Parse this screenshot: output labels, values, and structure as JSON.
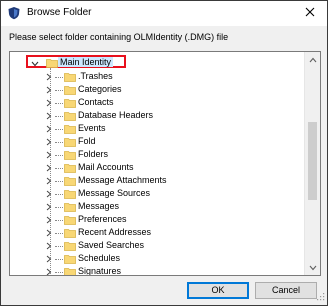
{
  "window": {
    "title": "Browse Folder",
    "close_icon": "close-icon",
    "app_icon": "shield-app-icon"
  },
  "prompt": "Please select folder containing OLMIdentity (.DMG) file",
  "tree": {
    "root": {
      "label": "Main Identity",
      "expanded": true,
      "selected": true,
      "icon": "folder-icon"
    },
    "children": [
      {
        "label": ".Trashes"
      },
      {
        "label": "Categories"
      },
      {
        "label": "Contacts"
      },
      {
        "label": "Database Headers"
      },
      {
        "label": "Events"
      },
      {
        "label": "Fold"
      },
      {
        "label": "Folders"
      },
      {
        "label": "Mail Accounts"
      },
      {
        "label": "Message Attachments"
      },
      {
        "label": "Message Sources"
      },
      {
        "label": "Messages"
      },
      {
        "label": "Preferences"
      },
      {
        "label": "Recent Addresses"
      },
      {
        "label": "Saved Searches"
      },
      {
        "label": "Schedules"
      },
      {
        "label": "Signatures"
      }
    ]
  },
  "buttons": {
    "ok": "OK",
    "cancel": "Cancel"
  },
  "colors": {
    "selection_highlight": "#cce8ff",
    "annotation_border": "#e8101d",
    "folder_yellow": "#f8d775",
    "default_button_border": "#0078d7"
  }
}
